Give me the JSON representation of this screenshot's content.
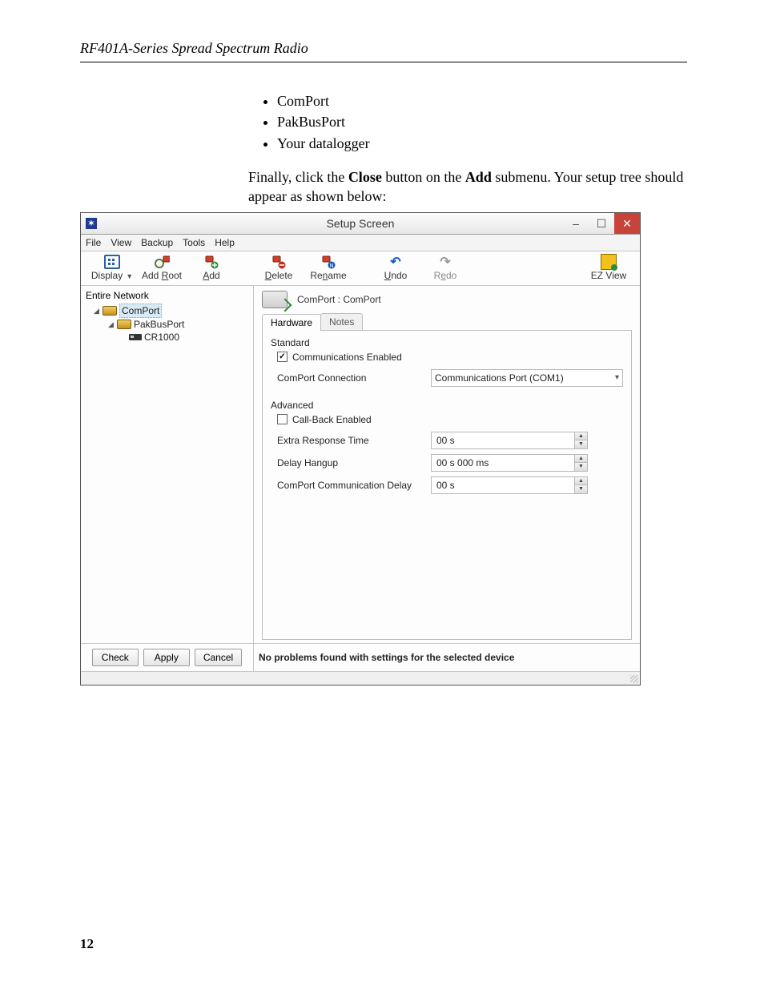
{
  "doc": {
    "running_head": "RF401A-Series Spread Spectrum Radio",
    "bullets": [
      "ComPort",
      "PakBusPort",
      "Your datalogger"
    ],
    "para_prefix": "Finally, click the ",
    "para_bold1": "Close",
    "para_mid": " button on the ",
    "para_bold2": "Add",
    "para_suffix": " submenu.  Your setup tree should appear as shown below:",
    "page_number": "12"
  },
  "window": {
    "title": "Setup Screen",
    "menu": [
      "File",
      "View",
      "Backup",
      "Tools",
      "Help"
    ],
    "toolbar": {
      "display": "Display",
      "add_root": "Add Root",
      "add": "Add",
      "delete": "Delete",
      "rename": "Rename",
      "undo": "Undo",
      "redo": "Redo",
      "ez_view": "EZ View"
    },
    "tree": {
      "root": "Entire Network",
      "n1": "ComPort",
      "n2": "PakBusPort",
      "n3": "CR1000"
    },
    "detail": {
      "header": "ComPort : ComPort",
      "tab_hw": "Hardware",
      "tab_notes": "Notes",
      "section_std": "Standard",
      "chk_comm_enabled": "Communications Enabled",
      "lbl_comport_conn": "ComPort Connection",
      "val_comport_conn": "Communications Port (COM1)",
      "section_adv": "Advanced",
      "chk_callback": "Call-Back Enabled",
      "lbl_extra_resp": "Extra Response Time",
      "val_extra_resp": "00 s",
      "lbl_delay_hangup": "Delay Hangup",
      "val_delay_hangup": "00 s 000 ms",
      "lbl_comm_delay": "ComPort Communication Delay",
      "val_comm_delay": "00 s"
    },
    "buttons": {
      "check": "Check",
      "apply": "Apply",
      "cancel": "Cancel"
    },
    "status": "No problems found with settings for the selected device"
  }
}
